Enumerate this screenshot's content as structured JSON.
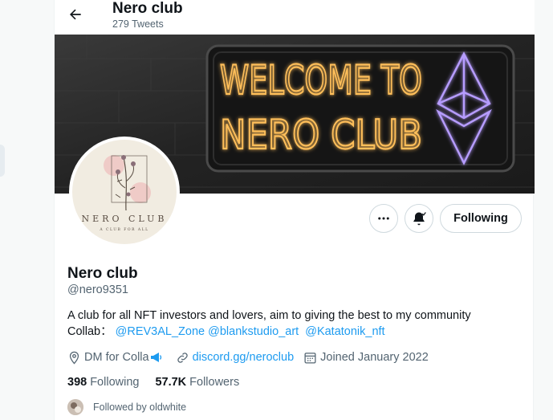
{
  "header": {
    "title": "Nero club",
    "tweet_count": "279 Tweets"
  },
  "banner": {
    "line1": "WELCOME TO",
    "line2": "NERO CLUB"
  },
  "avatar": {
    "brand": "NERO CLUB",
    "tagline": "A CLUB FOR ALL"
  },
  "actions": {
    "following_label": "Following"
  },
  "profile": {
    "name": "Nero club",
    "handle": "@nero9351",
    "bio_line1": "A club for all NFT investors and lovers, aim to giving the best to my community",
    "bio_collab_prefix": "Collab：",
    "bio_mentions": [
      "@REV3AL_Zone",
      "@blankstudio_art",
      "@Katatonik_nft"
    ],
    "location": "DM for Colla",
    "website": "discord.gg/neroclub",
    "joined": "Joined January 2022"
  },
  "stats": {
    "following_count": "398",
    "following_label": "Following",
    "followers_count": "57.7K",
    "followers_label": "Followers"
  },
  "followed_by": "Followed by oldwhite",
  "colors": {
    "accent": "#1d9bf0",
    "text": "#0f1419",
    "muted": "#536471",
    "neon_orange": "#ffb347",
    "neon_purple": "#a78bfa"
  }
}
